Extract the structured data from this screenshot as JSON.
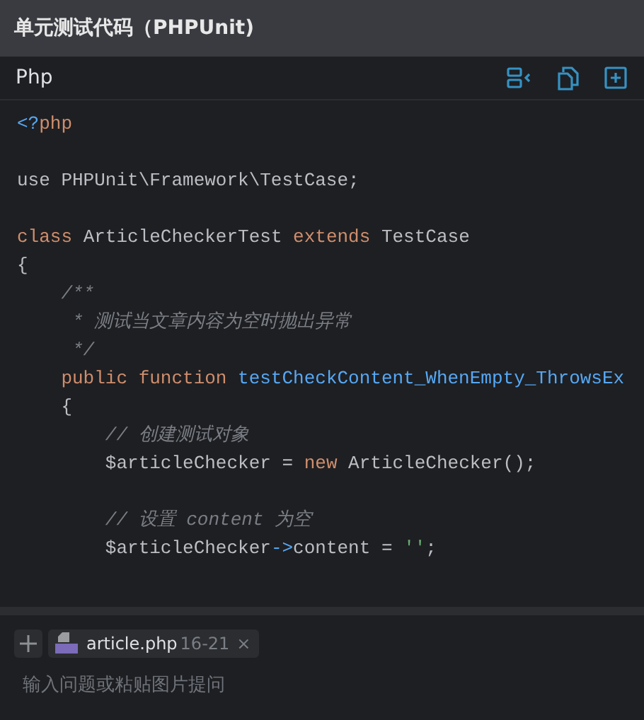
{
  "title": "单元测试代码（PHPUnit)",
  "code_block": {
    "language": "Php",
    "lines": [
      {
        "kind": "code",
        "tokens": [
          {
            "kind": "tag",
            "text": "<?"
          },
          {
            "kind": "keyword",
            "text": "php"
          }
        ]
      },
      {
        "kind": "blank"
      },
      {
        "kind": "code",
        "tokens": [
          {
            "kind": "plain",
            "text": "use PHPUnit\\Framework\\TestCase;"
          }
        ]
      },
      {
        "kind": "blank"
      },
      {
        "kind": "code",
        "tokens": [
          {
            "kind": "keyword",
            "text": "class"
          },
          {
            "kind": "plain",
            "text": " ArticleCheckerTest "
          },
          {
            "kind": "keyword",
            "text": "extends"
          },
          {
            "kind": "plain",
            "text": " TestCase"
          }
        ]
      },
      {
        "kind": "code",
        "tokens": [
          {
            "kind": "plain",
            "text": "{"
          }
        ]
      },
      {
        "kind": "code",
        "tokens": [
          {
            "kind": "comment",
            "text": "    /**"
          }
        ]
      },
      {
        "kind": "code",
        "tokens": [
          {
            "kind": "comment",
            "text": "     * 测试当文章内容为空时抛出异常"
          }
        ]
      },
      {
        "kind": "code",
        "tokens": [
          {
            "kind": "comment",
            "text": "     */"
          }
        ]
      },
      {
        "kind": "code",
        "tokens": [
          {
            "kind": "keyword",
            "text": "    public function "
          },
          {
            "kind": "function",
            "text": "testCheckContent_WhenEmpty_ThrowsEx"
          }
        ]
      },
      {
        "kind": "code",
        "tokens": [
          {
            "kind": "plain",
            "text": "    {"
          }
        ]
      },
      {
        "kind": "code",
        "tokens": [
          {
            "kind": "comment",
            "text": "        // 创建测试对象"
          }
        ]
      },
      {
        "kind": "code",
        "tokens": [
          {
            "kind": "plain",
            "text": "        $articleChecker = "
          },
          {
            "kind": "keyword",
            "text": "new"
          },
          {
            "kind": "plain",
            "text": " ArticleChecker();"
          }
        ]
      },
      {
        "kind": "blank"
      },
      {
        "kind": "code",
        "tokens": [
          {
            "kind": "comment",
            "text": "        // 设置 content 为空"
          }
        ]
      },
      {
        "kind": "code",
        "tokens": [
          {
            "kind": "plain",
            "text": "        $articleChecker"
          },
          {
            "kind": "tag",
            "text": "->"
          },
          {
            "kind": "plain",
            "text": "content = "
          },
          {
            "kind": "string",
            "text": "''"
          },
          {
            "kind": "plain",
            "text": ";"
          }
        ]
      },
      {
        "kind": "blank"
      }
    ]
  },
  "attachment": {
    "file": "article.php",
    "lines": "16-21",
    "close": "×"
  },
  "input": {
    "placeholder": "输入问题或粘贴图片提问"
  }
}
